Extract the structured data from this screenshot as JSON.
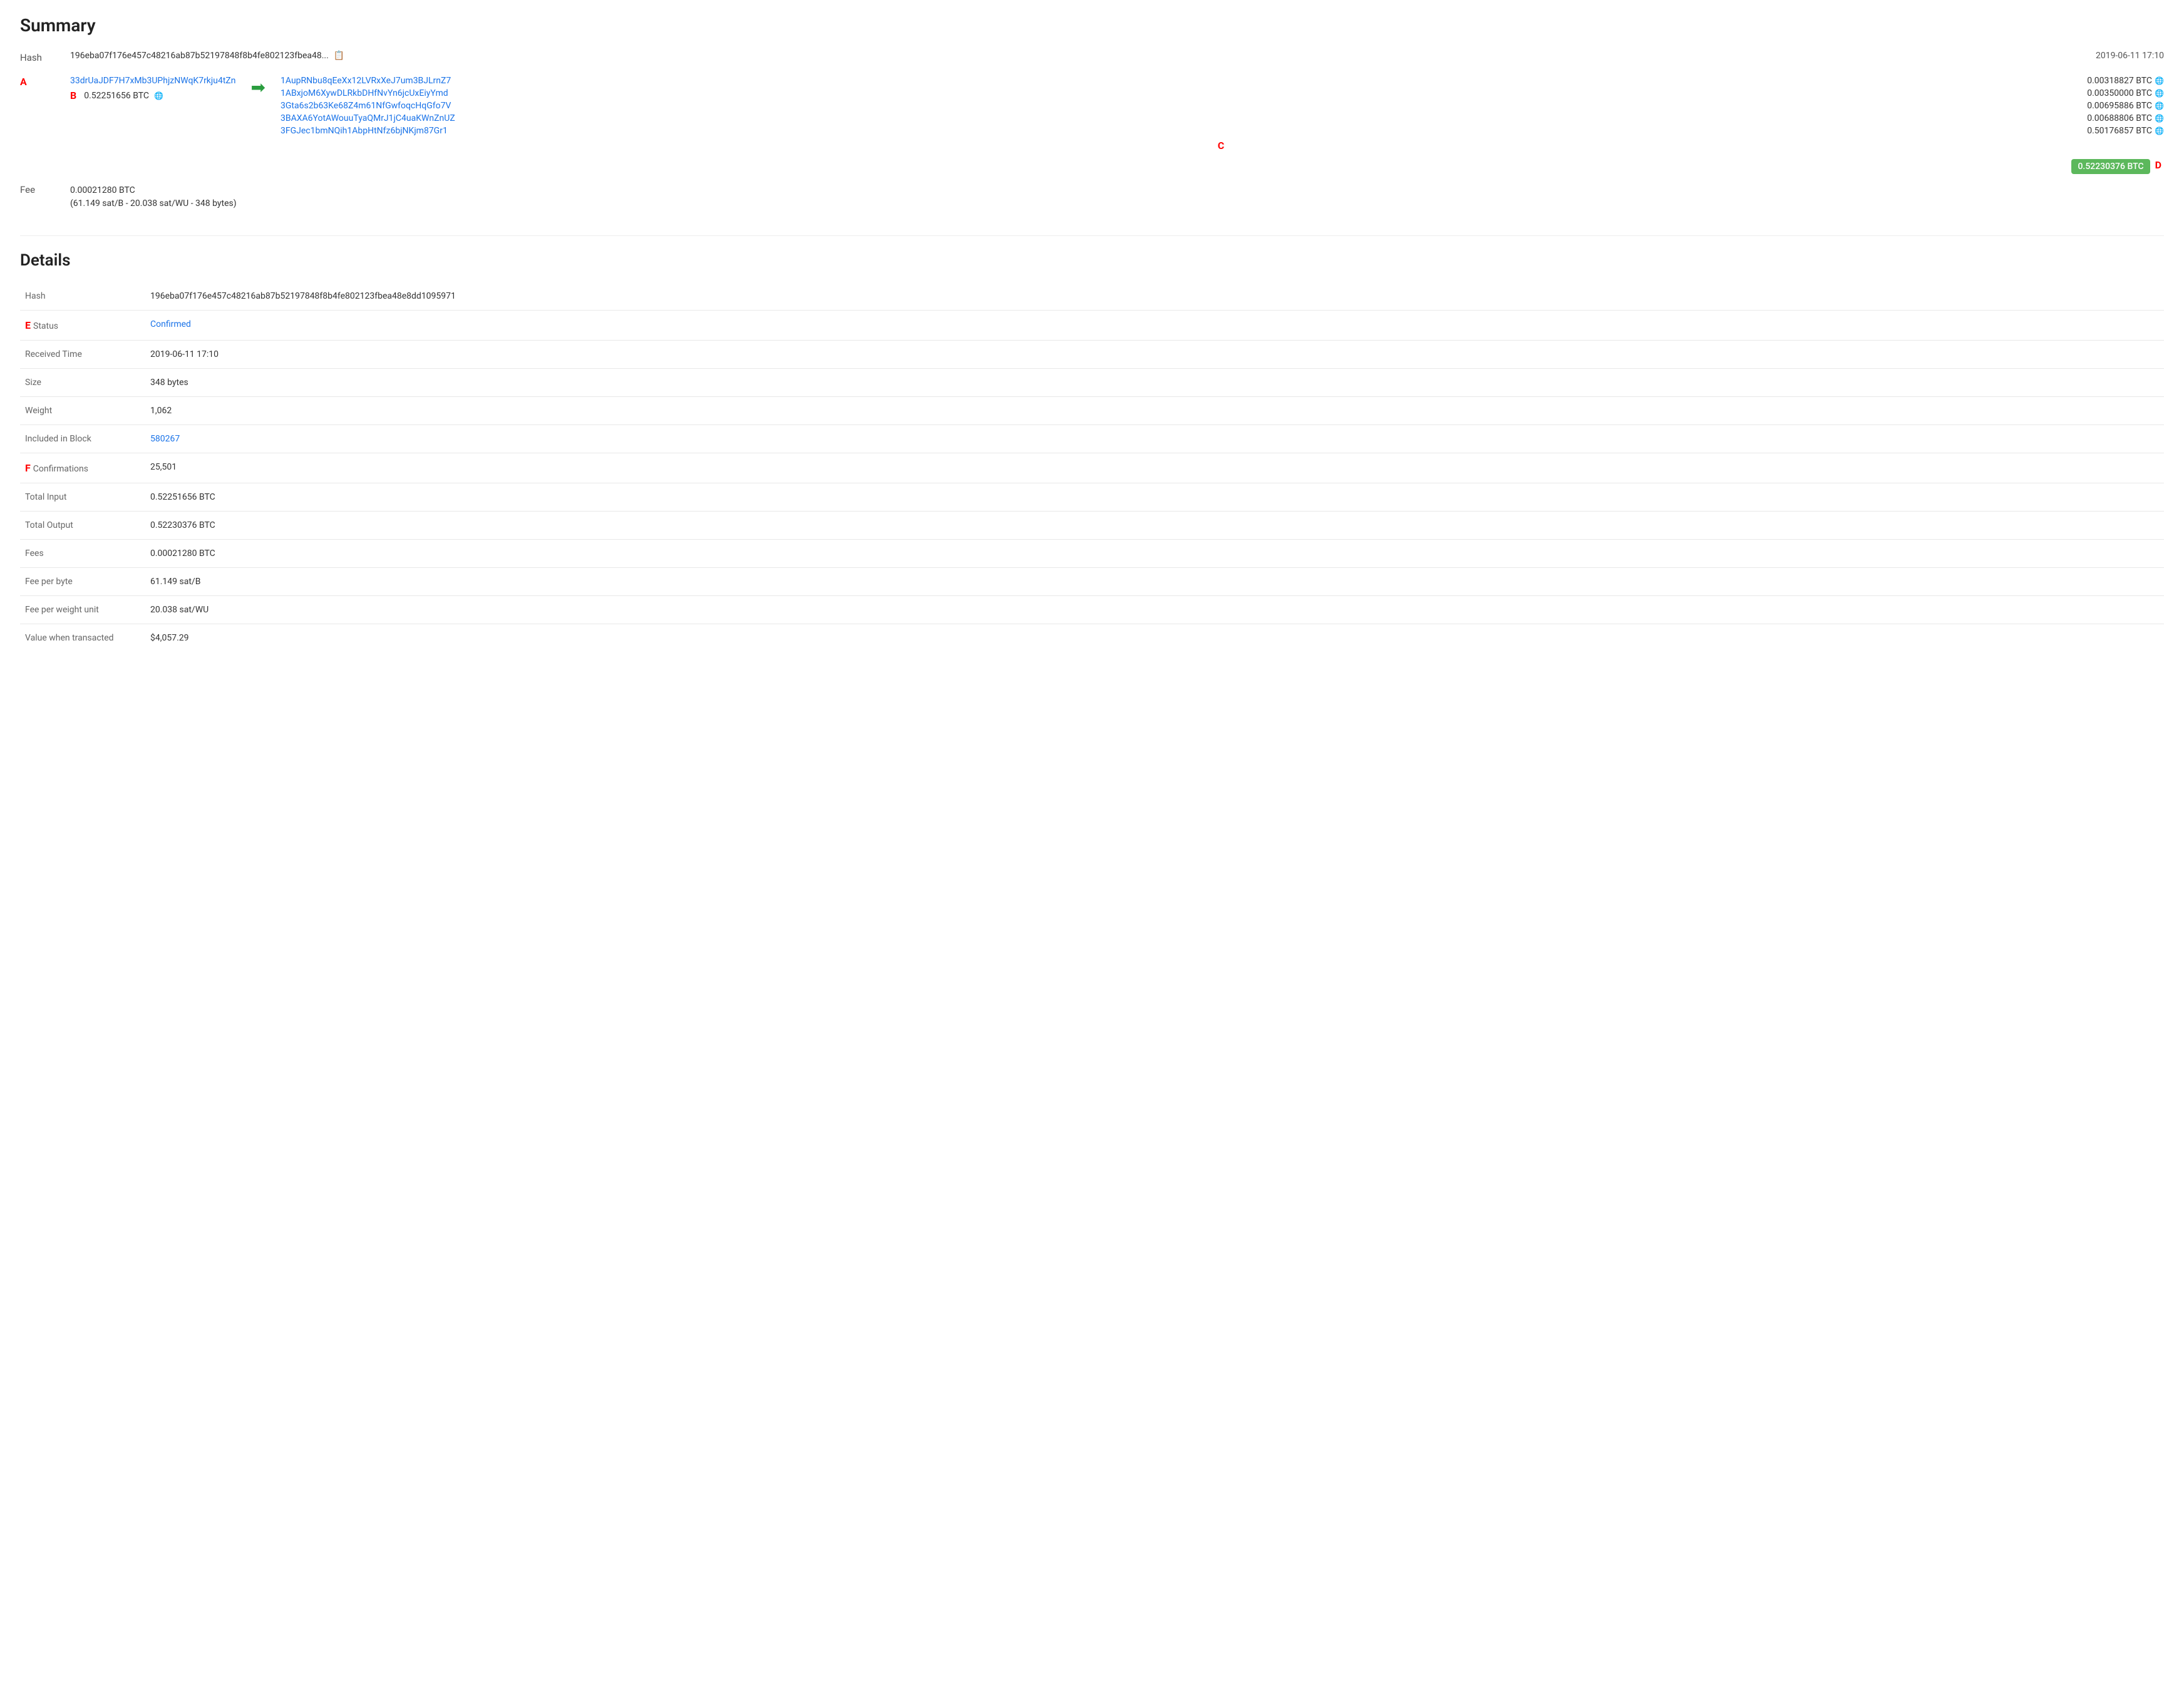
{
  "summary": {
    "title": "Summary",
    "hash_short": "196eba07f176e457c48216ab87b52197848f8b4fe802123fbea48...",
    "hash_full": "196eba07f176e457c48216ab87b52197848f8b4fe802123fbea48e8dd1095971",
    "timestamp": "2019-06-11 17:10",
    "input_address": "33drUaJDF7H7xMb3UPhjzNWqK7rkju4tZn",
    "input_amount": "0.52251656 BTC",
    "outputs": [
      {
        "address": "1AupRNbu8qEeXx12LVRxXeJ7um3BJLrnZ7",
        "amount": "0.00318827 BTC"
      },
      {
        "address": "1ABxjoM6XywDLRkbDHfNvYn6jcUxEiyYmd",
        "amount": "0.00350000 BTC"
      },
      {
        "address": "3Gta6s2b63Ke68Z4m61NfGwfoqcHqGfo7V",
        "amount": "0.00695886 BTC"
      },
      {
        "address": "3BAXA6YotAWouuTyaQMrJ1jC4uaKWnZnUZ",
        "amount": "0.00688806 BTC"
      },
      {
        "address": "3FGJec1bmNQih1AbpHtNfz6bjNKjm87Gr1",
        "amount": "0.50176857 BTC"
      }
    ],
    "total_output_badge": "0.52230376 BTC",
    "fee_line1": "0.00021280 BTC",
    "fee_line2": "(61.149 sat/B - 20.038 sat/WU - 348 bytes)",
    "labels": {
      "hash": "Hash",
      "fee": "Fee"
    },
    "anno_a": "A",
    "anno_b": "B",
    "anno_c": "C",
    "anno_d": "D"
  },
  "details": {
    "title": "Details",
    "fields": [
      {
        "name": "Hash",
        "value": "196eba07f176e457c48216ab87b52197848f8b4fe802123fbea48e8dd1095971",
        "type": "text"
      },
      {
        "name": "Status",
        "value": "Confirmed",
        "type": "status"
      },
      {
        "name": "Received Time",
        "value": "2019-06-11 17:10",
        "type": "text"
      },
      {
        "name": "Size",
        "value": "348 bytes",
        "type": "text"
      },
      {
        "name": "Weight",
        "value": "1,062",
        "type": "text"
      },
      {
        "name": "Included in Block",
        "value": "580267",
        "type": "link"
      },
      {
        "name": "Confirmations",
        "value": "25,501",
        "type": "text"
      },
      {
        "name": "Total Input",
        "value": "0.52251656 BTC",
        "type": "text"
      },
      {
        "name": "Total Output",
        "value": "0.52230376 BTC",
        "type": "text"
      },
      {
        "name": "Fees",
        "value": "0.00021280 BTC",
        "type": "text"
      },
      {
        "name": "Fee per byte",
        "value": "61.149 sat/B",
        "type": "text"
      },
      {
        "name": "Fee per weight unit",
        "value": "20.038 sat/WU",
        "type": "text"
      },
      {
        "name": "Value when transacted",
        "value": "$4,057.29",
        "type": "text"
      }
    ],
    "anno_e": "E",
    "anno_f": "F"
  }
}
